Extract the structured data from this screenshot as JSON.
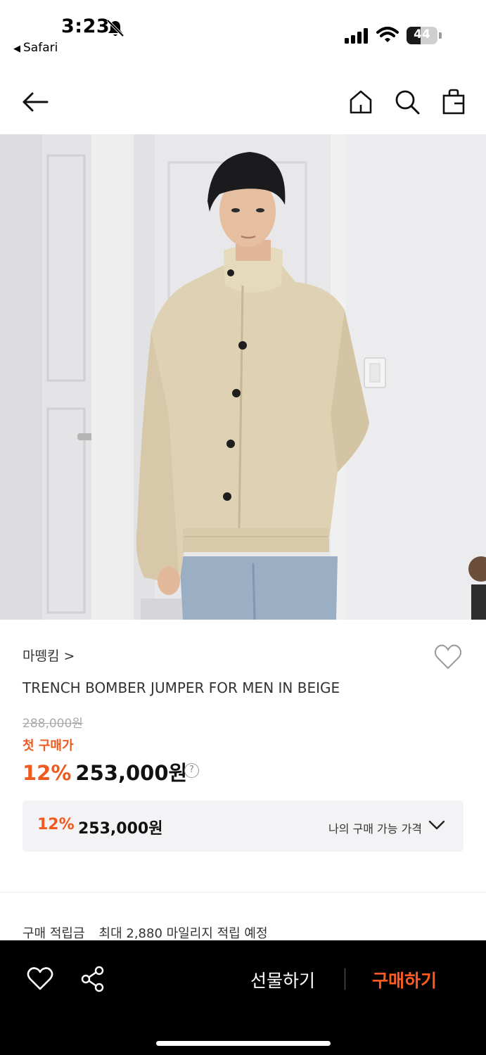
{
  "status_bar": {
    "time": "3:23",
    "back_app": "Safari",
    "battery": "44"
  },
  "nav": {
    "icons": [
      "back-arrow-icon",
      "home-icon",
      "search-icon",
      "shopping-bag-icon"
    ]
  },
  "product": {
    "image_alt": "Model wearing beige trench bomber jumper",
    "brand": "마뗑킴 >",
    "title": "TRENCH BOMBER JUMPER FOR MEN IN BEIGE",
    "original_price": "288,000원",
    "first_purchase_label": "첫 구매가",
    "discount_pct": "12%",
    "sale_price": "253,000원",
    "help_icon_text": "?"
  },
  "my_price": {
    "discount_pct": "12%",
    "price": "253,000원",
    "label": "나의 구매 가능 가격"
  },
  "points": {
    "label": "구매 적립금",
    "text": "최대 2,880 마일리지 적립 예정"
  },
  "bottom_bar": {
    "gift_label": "선물하기",
    "buy_label": "구매하기"
  },
  "colors": {
    "accent": "#ef5a1f",
    "bottom_bar_bg": "#000000",
    "buy_button": "#ff5a1f"
  }
}
